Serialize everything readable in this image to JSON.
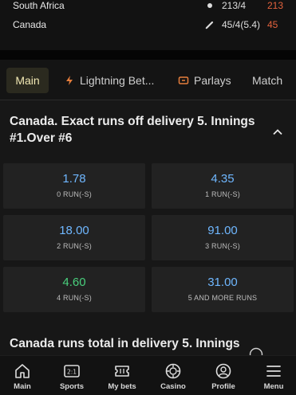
{
  "match": {
    "teams": [
      {
        "name": "South Africa",
        "score": "213/4",
        "extra": "213",
        "indicator": "dot-icon"
      },
      {
        "name": "Canada",
        "score": "45/4(5.4)",
        "extra": "45",
        "indicator": "bat-icon"
      }
    ]
  },
  "tabs": [
    {
      "label": "Main",
      "active": true
    },
    {
      "label": "Lightning Bet...",
      "icon": "lightning-icon"
    },
    {
      "label": "Parlays",
      "icon": "parlay-icon"
    },
    {
      "label": "Match"
    }
  ],
  "market": {
    "title": "Canada. Exact runs off delivery 5. Innings #1.Over #6",
    "odds": [
      {
        "price": "1.78",
        "label": "0 RUN(-S)"
      },
      {
        "price": "4.35",
        "label": "1 RUN(-S)"
      },
      {
        "price": "18.00",
        "label": "2 RUN(-S)"
      },
      {
        "price": "91.00",
        "label": "3 RUN(-S)"
      },
      {
        "price": "4.60",
        "label": "4 RUN(-S)",
        "trend": "up"
      },
      {
        "price": "31.00",
        "label": "5 AND MORE RUNS"
      }
    ]
  },
  "next_market": {
    "title": "Canada runs total in delivery 5. Innings"
  },
  "bottom_nav": [
    {
      "label": "Main",
      "icon": "home-icon"
    },
    {
      "label": "Sports",
      "icon": "scoreboard-icon"
    },
    {
      "label": "My bets",
      "icon": "ticket-icon"
    },
    {
      "label": "Casino",
      "icon": "chip-icon"
    },
    {
      "label": "Profile",
      "icon": "profile-icon"
    },
    {
      "label": "Menu",
      "icon": "menu-icon"
    }
  ],
  "colors": {
    "accent_blue": "#6fb7ff",
    "up_green": "#49d07d",
    "score_orange": "#e3623d",
    "active_tab_text": "#f2e9b4"
  }
}
